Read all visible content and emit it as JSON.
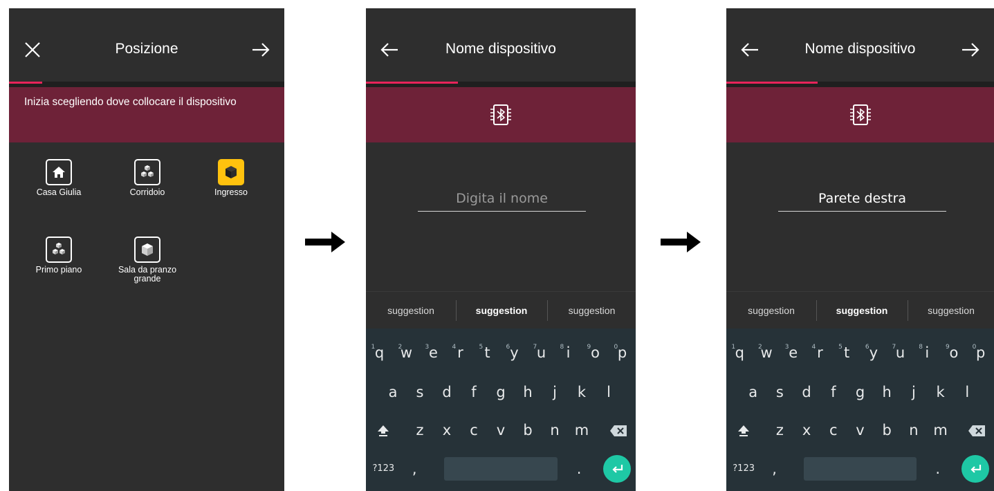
{
  "screen1": {
    "title": "Posizione",
    "instruction": "Inizia scegliendo dove collocare il dispositivo",
    "progress_percent": 12,
    "places": [
      {
        "label": "Casa Giulia",
        "icon": "home-icon",
        "selected": false
      },
      {
        "label": "Corridoio",
        "icon": "cubes-icon",
        "selected": false
      },
      {
        "label": "Ingresso",
        "icon": "cube-icon",
        "selected": true
      },
      {
        "label": "Primo piano",
        "icon": "cubes-icon",
        "selected": false
      },
      {
        "label": "Sala da pranzo grande",
        "label_line1": "Sala da pranzo",
        "label_line2": "grande",
        "icon": "cube-icon",
        "selected": false
      }
    ]
  },
  "screen2": {
    "title": "Nome dispositivo",
    "progress_percent": 34,
    "name_placeholder": "Digita il nome",
    "name_value": ""
  },
  "screen3": {
    "title": "Nome dispositivo",
    "progress_percent": 34,
    "name_value": "Parete destra"
  },
  "keyboard": {
    "suggestions": [
      "suggestion",
      "suggestion",
      "suggestion"
    ],
    "row1": [
      "q",
      "w",
      "e",
      "r",
      "t",
      "y",
      "u",
      "i",
      "o",
      "p"
    ],
    "row1_hints": [
      "1",
      "2",
      "3",
      "4",
      "5",
      "6",
      "7",
      "8",
      "9",
      "0"
    ],
    "row2": [
      "a",
      "s",
      "d",
      "f",
      "g",
      "h",
      "j",
      "k",
      "l"
    ],
    "row3": [
      "z",
      "x",
      "c",
      "v",
      "b",
      "n",
      "m"
    ],
    "symbols_key": "?123",
    "comma_key": ",",
    "period_key": "."
  },
  "colors": {
    "accent": "#e8235a",
    "banner": "#6e2238",
    "selected_tile": "#ffc20e",
    "enter_key": "#1ec8a5",
    "keyboard_bg": "#263238",
    "screen_bg": "#2e2e2e"
  }
}
